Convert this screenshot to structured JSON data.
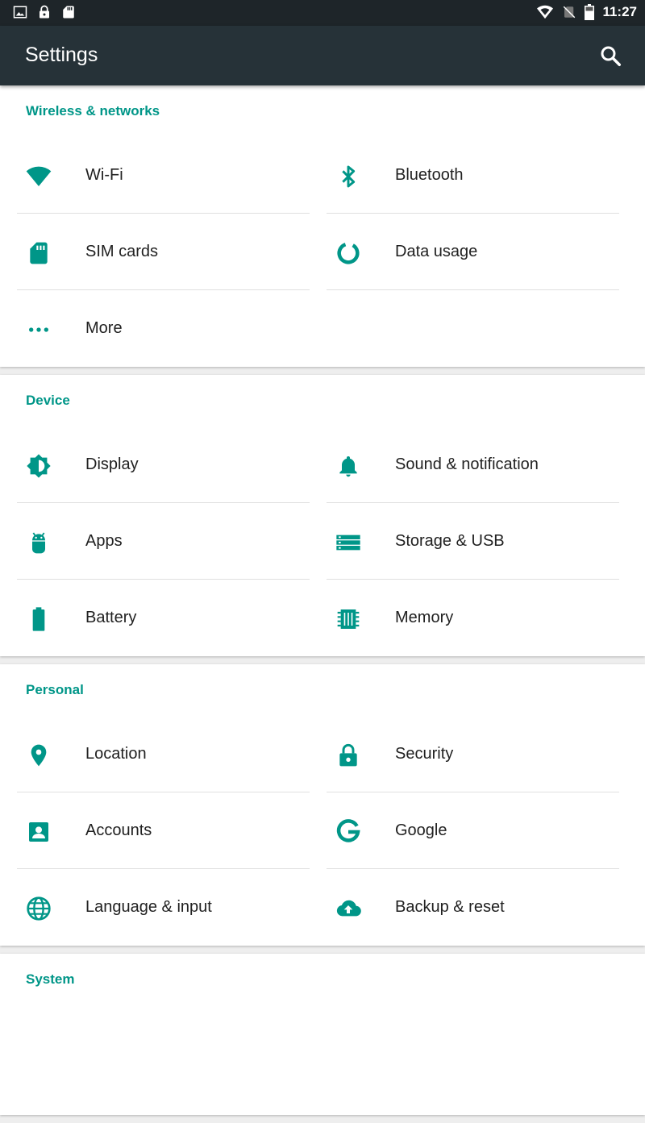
{
  "status_bar": {
    "time": "11:27",
    "left_icons": [
      "image-icon",
      "lock-icon",
      "sd-card-icon"
    ],
    "right_icons": [
      "wifi-icon",
      "no-sim-icon",
      "battery-icon"
    ]
  },
  "toolbar": {
    "title": "Settings",
    "search_icon": "search-icon"
  },
  "accent_color": "#009688",
  "toolbar_color": "#263238",
  "sections": [
    {
      "title": "Wireless & networks",
      "items": [
        {
          "label": "Wi-Fi",
          "icon": "wifi-icon"
        },
        {
          "label": "Bluetooth",
          "icon": "bluetooth-icon"
        },
        {
          "label": "SIM cards",
          "icon": "sim-card-icon"
        },
        {
          "label": "Data usage",
          "icon": "data-usage-icon"
        },
        {
          "label": "More",
          "icon": "more-icon"
        }
      ]
    },
    {
      "title": "Device",
      "items": [
        {
          "label": "Display",
          "icon": "brightness-icon"
        },
        {
          "label": "Sound & notification",
          "icon": "bell-icon"
        },
        {
          "label": "Apps",
          "icon": "android-icon"
        },
        {
          "label": "Storage & USB",
          "icon": "storage-icon"
        },
        {
          "label": "Battery",
          "icon": "battery-icon"
        },
        {
          "label": "Memory",
          "icon": "memory-chip-icon"
        }
      ]
    },
    {
      "title": "Personal",
      "items": [
        {
          "label": "Location",
          "icon": "location-pin-icon"
        },
        {
          "label": "Security",
          "icon": "lock-icon"
        },
        {
          "label": "Accounts",
          "icon": "account-box-icon"
        },
        {
          "label": "Google",
          "icon": "google-icon"
        },
        {
          "label": "Language & input",
          "icon": "globe-icon"
        },
        {
          "label": "Backup & reset",
          "icon": "cloud-upload-icon"
        }
      ]
    },
    {
      "title": "System",
      "items": []
    }
  ]
}
